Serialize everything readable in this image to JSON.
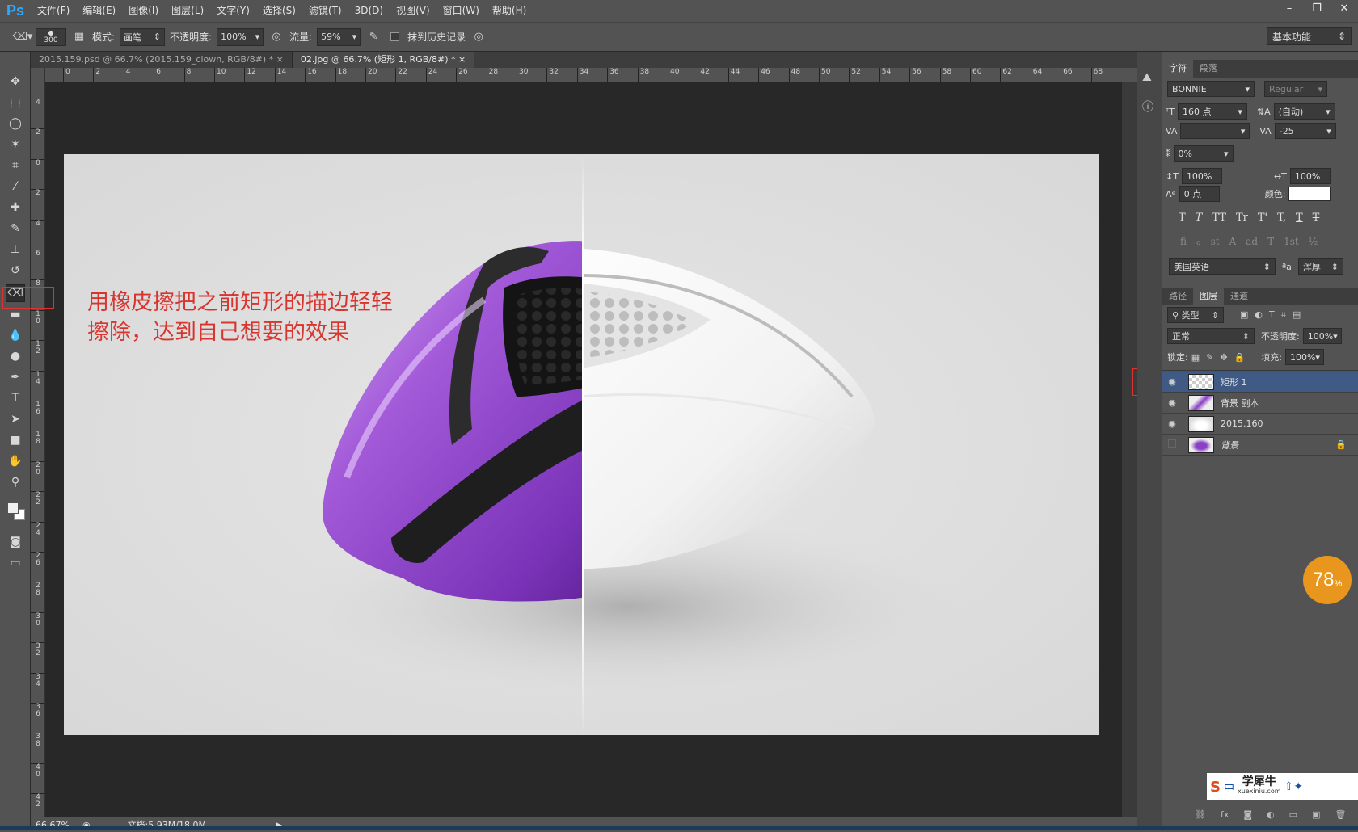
{
  "app": {
    "logo": "Ps"
  },
  "menu": [
    "文件(F)",
    "编辑(E)",
    "图像(I)",
    "图层(L)",
    "文字(Y)",
    "选择(S)",
    "滤镜(T)",
    "3D(D)",
    "视图(V)",
    "窗口(W)",
    "帮助(H)"
  ],
  "window_controls": [
    "–",
    "❐",
    "✕"
  ],
  "options": {
    "brush_size": "300",
    "mode_label": "模式:",
    "mode_value": "画笔",
    "opacity_label": "不透明度:",
    "opacity_value": "100%",
    "flow_label": "流量:",
    "flow_value": "59%",
    "erase_history": "抹到历史记录",
    "workspace": "基本功能"
  },
  "tabs": [
    {
      "label": "2015.159.psd @ 66.7% (2015.159_clown, RGB/8#) *  ×"
    },
    {
      "label": "02.jpg @ 66.7% (矩形 1, RGB/8#) *  ×"
    }
  ],
  "ruler_h": [
    "0",
    "2",
    "4",
    "6",
    "8",
    "10",
    "12",
    "14",
    "16",
    "18",
    "20",
    "22",
    "24",
    "26",
    "28",
    "30",
    "32",
    "34",
    "36",
    "38",
    "40",
    "42",
    "44",
    "46",
    "48",
    "50",
    "52",
    "54",
    "56",
    "58",
    "60",
    "62",
    "64",
    "66",
    "68"
  ],
  "ruler_v": [
    "4",
    "2",
    "0",
    "2",
    "4",
    "6",
    "8",
    "10",
    "12",
    "14",
    "16",
    "18",
    "20",
    "22",
    "24",
    "26",
    "28",
    "30",
    "32",
    "34",
    "36",
    "38",
    "40",
    "42"
  ],
  "annotation": {
    "line1": "用橡皮擦把之前矩形的描边轻轻",
    "line2": "擦除，达到自己想要的效果"
  },
  "status": {
    "zoom": "66.67%",
    "doc": "文档:5.93M/18.0M"
  },
  "char_panel": {
    "tabs": [
      "字符",
      "段落"
    ],
    "font": "BONNIE",
    "style": "Regular",
    "size": "160 点",
    "leading": "(自动)",
    "kerning": "",
    "tracking": "-25",
    "tsume": "0%",
    "v_scale": "100%",
    "h_scale": "100%",
    "baseline": "0 点",
    "color_label": "颜色:",
    "language": "美国英语",
    "aa_label": "ªa",
    "aa_value": "浑厚",
    "style_buttons": [
      "T",
      "T",
      "TT",
      "Tr",
      "T'",
      "T,",
      "T",
      "T"
    ],
    "ot_buttons": [
      "fi",
      "ℴ",
      "st",
      "A",
      "ad",
      "T",
      "1st",
      "½"
    ]
  },
  "layers_panel": {
    "tabs": [
      "路径",
      "图层",
      "通道"
    ],
    "filter": "类型",
    "blend": "正常",
    "opacity_label": "不透明度:",
    "opacity": "100%",
    "lock_label": "锁定:",
    "fill_label": "填充:",
    "fill": "100%",
    "layers": [
      {
        "name": "矩形 1",
        "selected": true,
        "visible": true
      },
      {
        "name": "背景 副本",
        "selected": false,
        "visible": true
      },
      {
        "name": "2015.160",
        "selected": false,
        "visible": true
      },
      {
        "name": "背景",
        "selected": false,
        "visible": false
      }
    ]
  },
  "badge": {
    "value": "78",
    "unit": "%"
  },
  "watermark": {
    "text": "学犀牛",
    "sub": "xuexiniu.com"
  },
  "colors": {
    "purple": "#8a3fc4",
    "accent_red": "#d8352f",
    "selection": "#3f5a84"
  }
}
